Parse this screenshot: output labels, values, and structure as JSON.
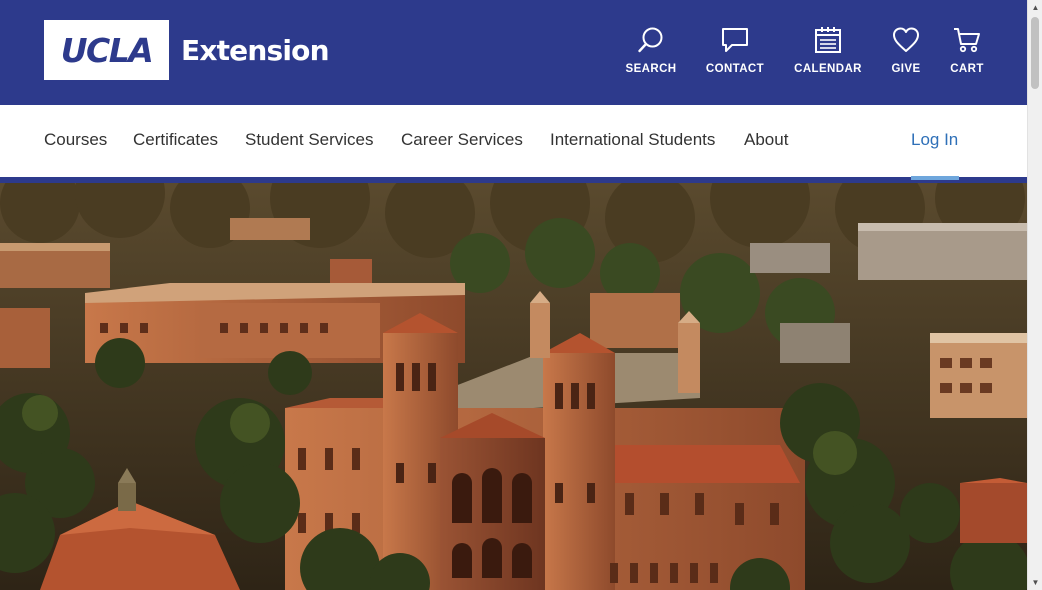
{
  "header": {
    "logo": {
      "ucla": "UCLA",
      "extension": "Extension"
    },
    "utilities": [
      {
        "label": "SEARCH",
        "icon": "search-icon"
      },
      {
        "label": "CONTACT",
        "icon": "chat-icon"
      },
      {
        "label": "CALENDAR",
        "icon": "calendar-icon"
      },
      {
        "label": "GIVE",
        "icon": "heart-icon"
      },
      {
        "label": "CART",
        "icon": "cart-icon"
      }
    ]
  },
  "nav": {
    "items": [
      {
        "label": "Courses"
      },
      {
        "label": "Certificates"
      },
      {
        "label": "Student Services"
      },
      {
        "label": "Career Services"
      },
      {
        "label": "International Students"
      },
      {
        "label": "About"
      }
    ],
    "login": "Log In"
  },
  "colors": {
    "brand_blue": "#2d3a8c",
    "link_blue": "#2f70b8",
    "active_underline": "#6ea6dc",
    "nav_text": "#333333"
  }
}
